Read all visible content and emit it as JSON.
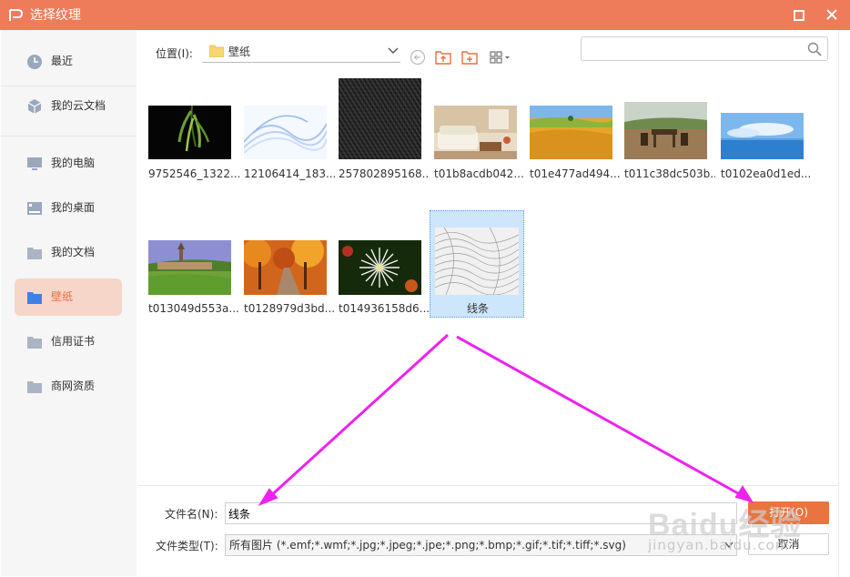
{
  "window": {
    "title": "选择纹理"
  },
  "sidebar": {
    "items": [
      {
        "label": "最近",
        "icon": "clock-icon"
      },
      {
        "label": "我的云文档",
        "icon": "cloud-docs-icon"
      },
      {
        "label": "我的电脑",
        "icon": "monitor-icon"
      },
      {
        "label": "我的桌面",
        "icon": "desktop-icon"
      },
      {
        "label": "我的文档",
        "icon": "folder-icon"
      },
      {
        "label": "壁纸",
        "icon": "folder-icon",
        "active": true
      },
      {
        "label": "信用证书",
        "icon": "folder-icon"
      },
      {
        "label": "商网资质",
        "icon": "folder-icon"
      }
    ]
  },
  "location": {
    "label": "位置(I):",
    "value": "壁纸"
  },
  "search": {
    "placeholder": ""
  },
  "files": [
    {
      "name": "9752546_1322...",
      "art": "bamboo"
    },
    {
      "name": "12106414_183...",
      "art": "blue-wave"
    },
    {
      "name": "257802895168...",
      "art": "black-knit"
    },
    {
      "name": "t01b8acdb042...",
      "art": "living-room"
    },
    {
      "name": "t01e477ad494...",
      "art": "wheat-field"
    },
    {
      "name": "t011c38dc503b...",
      "art": "terrace"
    },
    {
      "name": "t0102ea0d1ed...",
      "art": "sky-sea"
    },
    {
      "name": "t013049d553a...",
      "art": "village"
    },
    {
      "name": "t0128979d3bd...",
      "art": "autumn-road"
    },
    {
      "name": "t014936158d6...",
      "art": "white-flower"
    },
    {
      "name": "线条",
      "art": "lines",
      "selected": true
    }
  ],
  "footer": {
    "filename_label": "文件名(N):",
    "filename_value": "线条",
    "filetype_label": "文件类型(T):",
    "filetype_value": "所有图片 (*.emf;*.wmf;*.jpg;*.jpeg;*.jpe;*.png;*.bmp;*.gif;*.tif;*.tiff;*.svg)",
    "open_label": "打开(O)",
    "cancel_label": "取消"
  },
  "watermark": {
    "brand": "Baidu经验",
    "site": "jingyan.baidu.com"
  },
  "colors": {
    "titlebar": "#ee7c5b",
    "accent": "#e9743f",
    "selection": "#cde6fb",
    "annotation": "#ee22ee"
  }
}
